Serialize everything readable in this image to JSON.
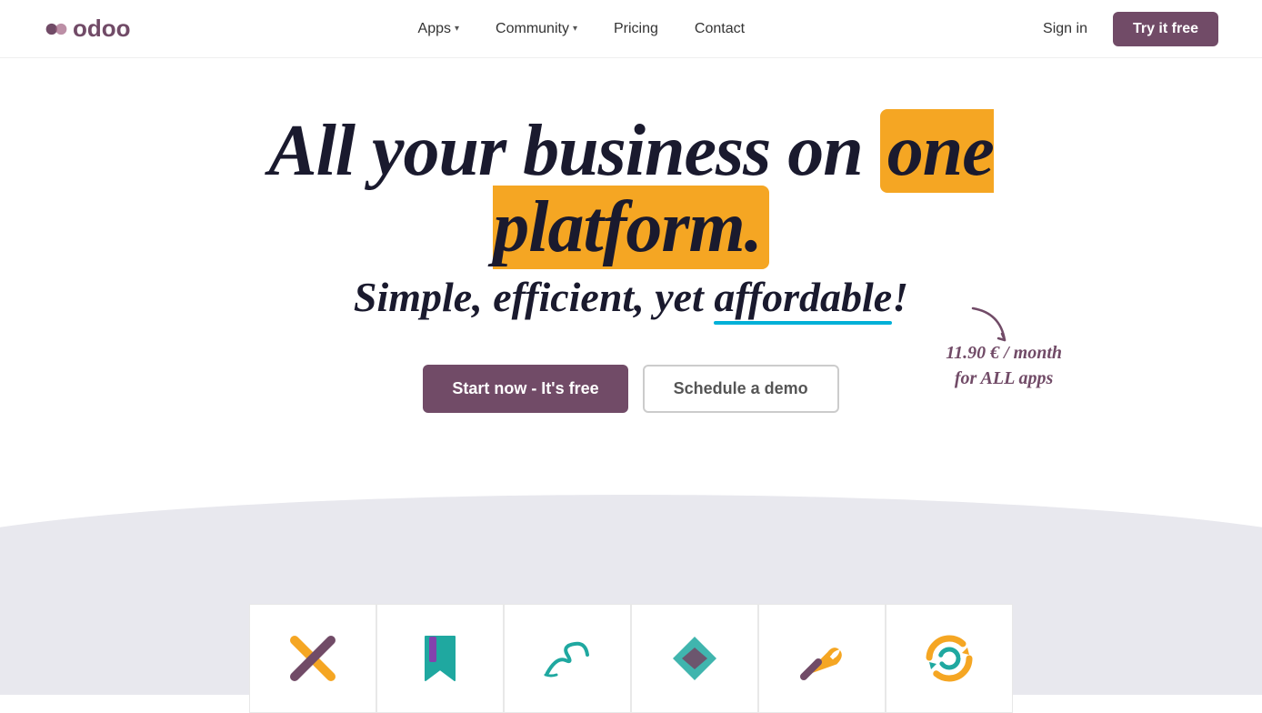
{
  "brand": {
    "name": "odoo"
  },
  "navbar": {
    "links": [
      {
        "label": "Apps",
        "has_dropdown": true
      },
      {
        "label": "Community",
        "has_dropdown": true
      },
      {
        "label": "Pricing",
        "has_dropdown": false
      },
      {
        "label": "Contact",
        "has_dropdown": false
      }
    ],
    "sign_in_label": "Sign in",
    "try_free_label": "Try it free"
  },
  "hero": {
    "title_part1": "All your business on ",
    "title_highlight": "one platform.",
    "subtitle_part1": "Simple, efficient, yet ",
    "subtitle_highlight": "affordable",
    "subtitle_part2": "!",
    "cta_primary": "Start now - It's free",
    "cta_secondary": "Schedule a demo",
    "price_annotation": "11.90 € / month\nfor ALL apps"
  },
  "colors": {
    "brand_purple": "#714B67",
    "highlight_yellow": "#F5A623",
    "underline_blue": "#00B0D8"
  }
}
